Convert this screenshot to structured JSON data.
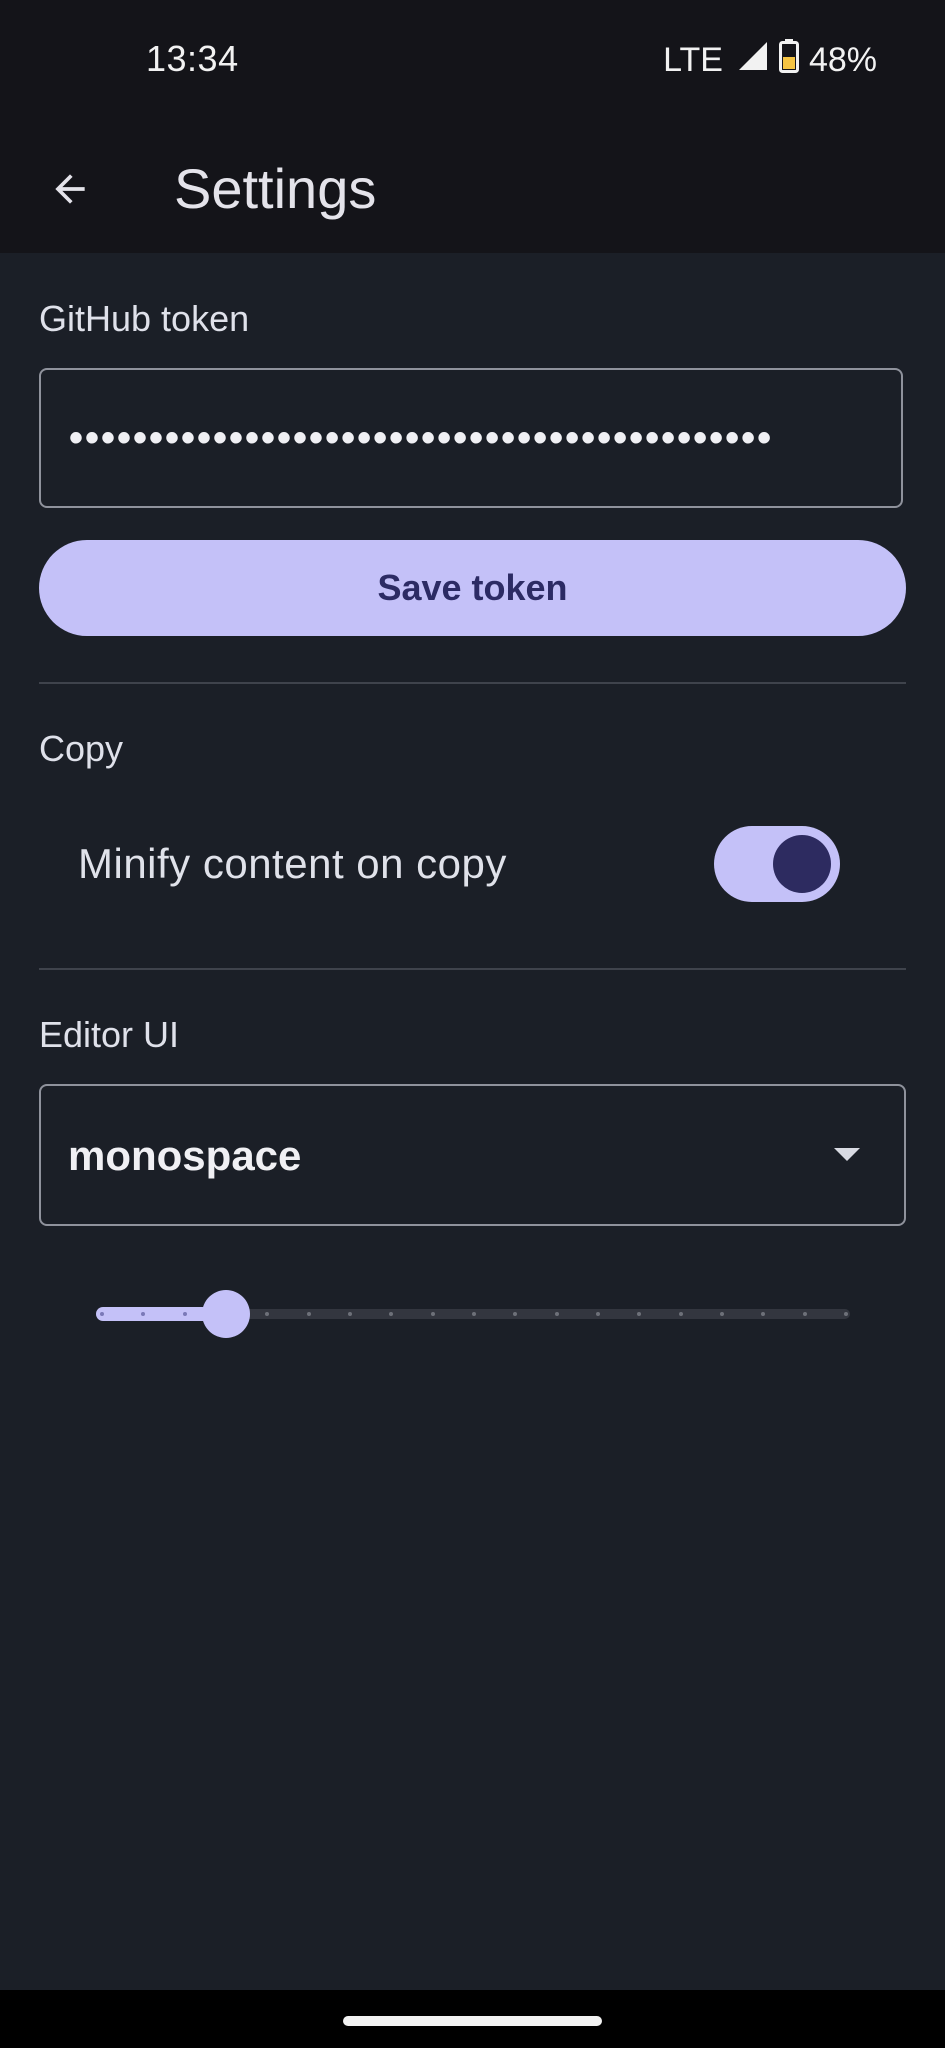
{
  "status_bar": {
    "time": "13:34",
    "network": "LTE",
    "battery": "48%",
    "icons": [
      "signal-icon",
      "battery-icon"
    ]
  },
  "app_bar": {
    "title": "Settings",
    "back_icon": "arrow-back-icon"
  },
  "github_token": {
    "label": "GitHub token",
    "masked_value": "••••••••••••••••••••••••••••••••••••••••••••",
    "save_label": "Save token"
  },
  "copy": {
    "label": "Copy",
    "minify_label": "Minify content on copy",
    "minify_enabled": true
  },
  "editor_ui": {
    "label": "Editor UI",
    "font_value": "monospace",
    "dropdown_icon": "arrow-drop-down-icon",
    "slider_step": 3,
    "slider_steps_total": 19
  },
  "colors": {
    "background": "#1b1f27",
    "app_bar": "#141419",
    "accent": "#c4c1f8",
    "on_accent": "#2c2b64"
  }
}
